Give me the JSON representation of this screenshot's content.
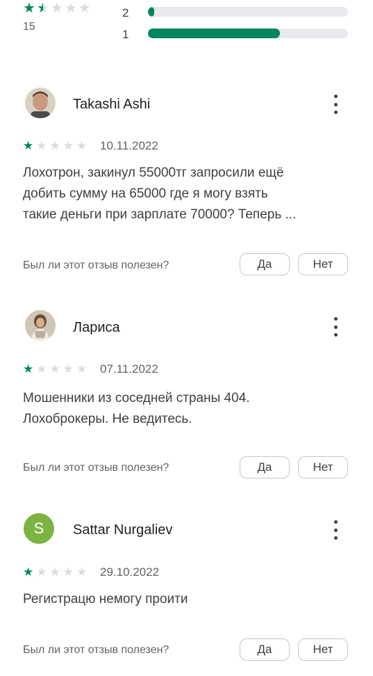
{
  "summary": {
    "rating_stars": 1.5,
    "review_count": "15",
    "bars": [
      {
        "label": "2",
        "fraction": 0.03
      },
      {
        "label": "1",
        "fraction": 0.66
      }
    ]
  },
  "reviews": [
    {
      "author": "Takashi Ashi",
      "stars": 1,
      "date": "10.11.2022",
      "text_lines": [
        "Лохотрон, закинул 55000тг запросили ещё",
        "добить сумму на 65000 где я могу взять",
        "такие деньги при зарплате 70000? Теперь ..."
      ],
      "helpful_question": "Был ли этот отзыв полезен?",
      "yes": "Да",
      "no": "Нет"
    },
    {
      "author": "Лариса",
      "stars": 1,
      "date": "07.11.2022",
      "text_lines": [
        "Мошенники из соседней страны 404.",
        "Лохоброкеры. Не ведитесь."
      ],
      "helpful_question": "Был ли этот отзыв полезен?",
      "yes": "Да",
      "no": "Нет"
    },
    {
      "author": "Sattar Nurgaliev",
      "avatar_letter": "S",
      "stars": 1,
      "date": "29.10.2022",
      "text_lines": [
        "Регистрацю немогу проити"
      ],
      "helpful_question": "Был ли этот отзыв полезен?",
      "yes": "Да",
      "no": "Нет"
    }
  ],
  "colors": {
    "accent": "#01875f",
    "avatar_s": "#7cb342"
  }
}
